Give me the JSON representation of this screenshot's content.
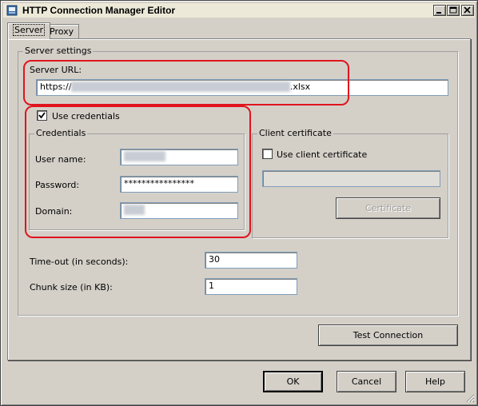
{
  "window": {
    "title": "HTTP Connection Manager Editor",
    "controls": [
      "minimize",
      "maximize",
      "close"
    ]
  },
  "tabs": [
    {
      "label": "Server",
      "active": true
    },
    {
      "label": "Proxy",
      "active": false
    }
  ],
  "server_settings": {
    "group_title": "Server settings",
    "server_url": {
      "label": "Server URL:",
      "value_prefix": "https://",
      "value_obscured": "blurred",
      "value_suffix": ".xlsx"
    },
    "use_credentials": {
      "label": "Use credentials",
      "checked": true
    },
    "credentials": {
      "group_title": "Credentials",
      "user_name_label": "User name:",
      "password_label": "Password:",
      "password_value": "****************",
      "domain_label": "Domain:"
    },
    "client_certificate": {
      "group_title": "Client certificate",
      "use_label": "Use client certificate",
      "checked": false,
      "certificate_button": "Certificate"
    },
    "timeout": {
      "label": "Time-out (in seconds):",
      "value": "30"
    },
    "chunk_size": {
      "label": "Chunk size (in KB):",
      "value": "1"
    }
  },
  "buttons": {
    "test_connection": "Test Connection",
    "ok": "OK",
    "cancel": "Cancel",
    "help": "Help"
  },
  "colors": {
    "highlight": "#e0141e",
    "dialog_bg": "#d4d0c8"
  }
}
